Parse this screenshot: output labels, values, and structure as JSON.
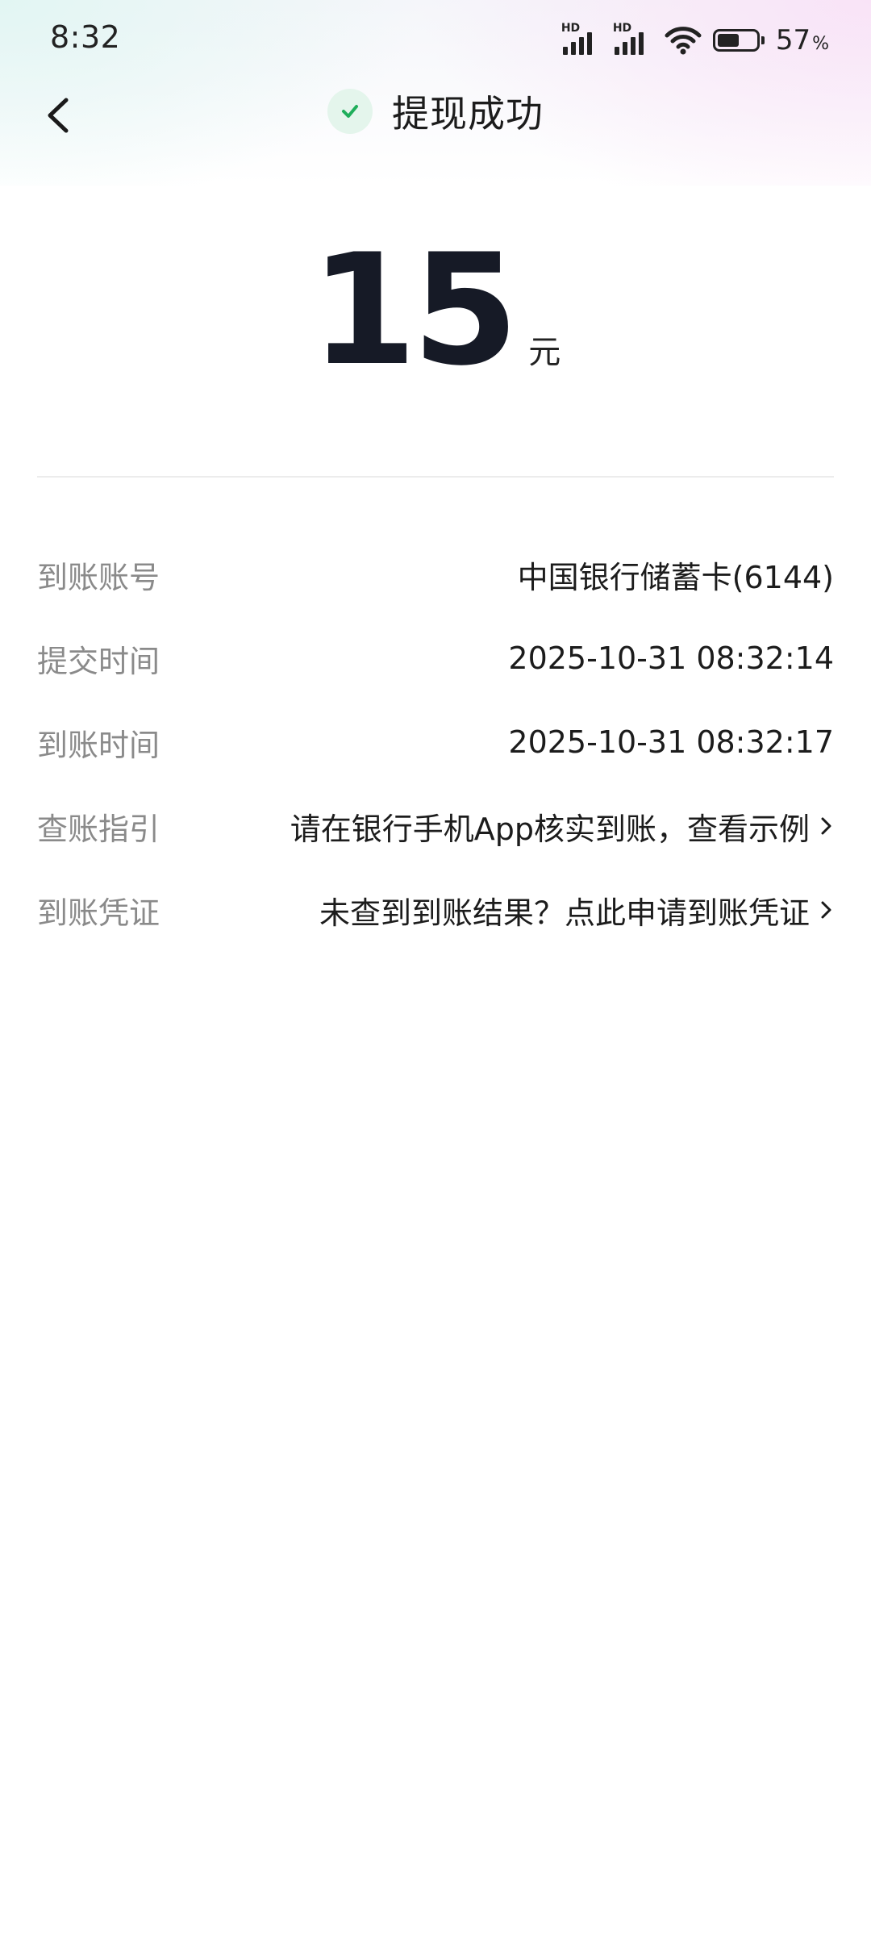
{
  "status_bar": {
    "time": "8:32",
    "signal_1_label": "HD",
    "signal_2_label": "HD",
    "battery_percent": "57",
    "battery_unit": "%",
    "battery_level": 0.57
  },
  "header": {
    "title": "提现成功",
    "back_icon": "chevron-left-icon",
    "status_icon": "check-circle-icon",
    "accent_color": "#1fae5b"
  },
  "amount": {
    "value": "15",
    "unit": "元"
  },
  "details": [
    {
      "label": "到账账号",
      "value": "中国银行储蓄卡(6144)"
    },
    {
      "label": "提交时间",
      "value": "2025-10-31 08:32:14"
    },
    {
      "label": "到账时间",
      "value": "2025-10-31 08:32:17"
    },
    {
      "label": "查账指引",
      "value": "请在银行手机App核实到账，查看示例"
    },
    {
      "label": "到账凭证",
      "value": "未查到到账结果？点此申请到账凭证"
    }
  ]
}
